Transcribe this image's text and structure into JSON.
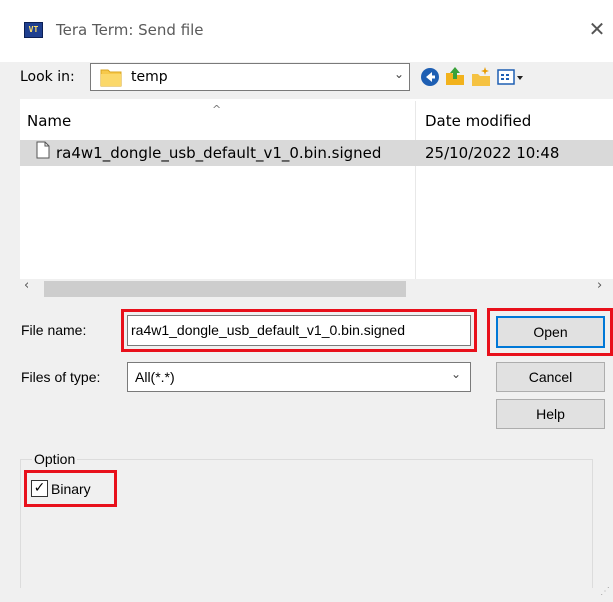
{
  "window": {
    "title": "Tera Term: Send file",
    "app_icon_text": "VT",
    "close_glyph": "✕"
  },
  "toolbar": {
    "look_in_label": "Look in:",
    "look_in_value": "temp",
    "dropdown_glyph": "⌄",
    "icons": [
      "back-icon",
      "up-folder-icon",
      "new-folder-icon",
      "view-menu-icon"
    ]
  },
  "file_list": {
    "columns": [
      "Name",
      "Date modified"
    ],
    "rows": [
      {
        "name": "ra4w1_dongle_usb_default_v1_0.bin.signed",
        "date": "25/10/2022 10:48",
        "selected": true
      }
    ],
    "scroll_left_glyph": "‹",
    "scroll_right_glyph": "›"
  },
  "form": {
    "file_name_label": "File name:",
    "file_name_value": "ra4w1_dongle_usb_default_v1_0.bin.signed",
    "files_of_type_label": "Files of type:",
    "files_of_type_value": "All(*.*)"
  },
  "buttons": {
    "open": "Open",
    "cancel": "Cancel",
    "help": "Help"
  },
  "option": {
    "group_label": "Option",
    "binary_label": "Binary",
    "binary_checked": true,
    "check_glyph": "✓"
  },
  "colors": {
    "highlight": "#e8101b",
    "focus_border": "#0078d7",
    "selected_row": "#d9d9d9"
  }
}
